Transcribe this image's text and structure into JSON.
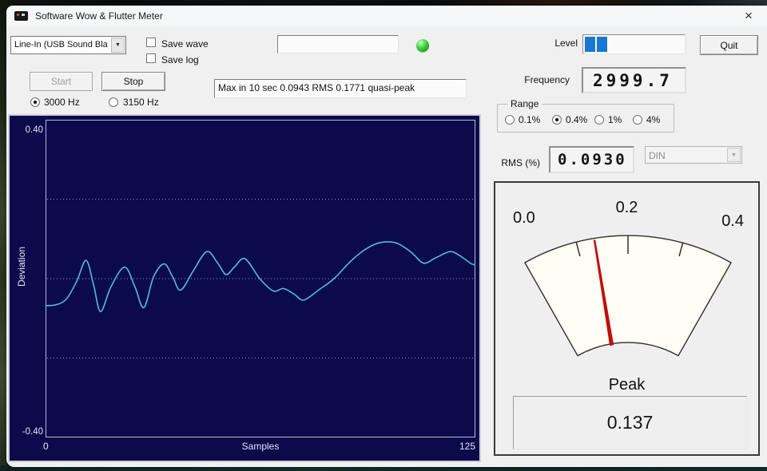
{
  "window": {
    "title": "Software Wow & Flutter Meter",
    "close_glyph": "×"
  },
  "icons": {
    "dropdown_arrow": "▼"
  },
  "controls": {
    "input_device": {
      "value": "Line-In (USB Sound Bla"
    },
    "save_wave": {
      "label": "Save wave",
      "checked": false
    },
    "save_log": {
      "label": "Save log",
      "checked": false
    },
    "filename_value": "",
    "start_label": "Start",
    "stop_label": "Stop",
    "freq_3000": {
      "label": "3000 Hz",
      "selected": true
    },
    "freq_3150": {
      "label": "3150 Hz",
      "selected": false
    },
    "status_text": "Max in 10 sec 0.0943 RMS 0.1771 quasi-peak",
    "level": {
      "label": "Level",
      "segments": 2,
      "color": "#1777d2"
    },
    "quit_label": "Quit",
    "frequency_label": "Frequency",
    "frequency_value": "2999.7",
    "range": {
      "label": "Range",
      "options": [
        {
          "label": "0.1%",
          "selected": false
        },
        {
          "label": "0.4%",
          "selected": true
        },
        {
          "label": "1%",
          "selected": false
        },
        {
          "label": "4%",
          "selected": false
        }
      ]
    },
    "rms_label": "RMS (%)",
    "rms_value": "0.0930",
    "weighting_value": "DIN"
  },
  "meter": {
    "scale_labels": [
      "0.0",
      "0.2",
      "0.4"
    ],
    "min": 0,
    "max": 0.4,
    "value": 0.137,
    "needle_color": "#c40c0c",
    "peak_label": "Peak",
    "peak_value": "0.137"
  },
  "chart_data": {
    "type": "line",
    "title": "",
    "xlabel": "Samples",
    "ylabel": "Deviation",
    "x_ticks": [
      "0",
      "125"
    ],
    "y_tick_top": "0.40",
    "y_tick_bottom": "-0.40",
    "xlim": [
      0,
      125
    ],
    "ylim": [
      -0.4,
      0.4
    ],
    "gridlines_y": [
      0.2,
      0,
      -0.2
    ],
    "legend": "none",
    "series": [
      {
        "name": "deviation",
        "x": [
          0,
          3,
          6,
          9,
          11.8,
          14,
          16,
          19,
          23,
          26,
          28.6,
          31.4,
          34.5,
          37,
          39.3,
          43,
          46.9,
          50,
          52.5,
          55,
          58,
          62.3,
          66.2,
          69.2,
          72.3,
          75.1,
          79.7,
          83.9,
          89,
          93.6,
          97.6,
          102.2,
          106.4,
          109.9,
          113.4,
          117.6,
          120.4,
          123.9,
          125
        ],
        "y": [
          -0.068,
          -0.066,
          -0.052,
          -0.008,
          0.046,
          -0.017,
          -0.083,
          -0.021,
          0.029,
          -0.021,
          -0.073,
          0.004,
          0.037,
          0.004,
          -0.029,
          0.02,
          0.068,
          0.04,
          0.01,
          0.03,
          0.05,
          0.0,
          -0.031,
          -0.025,
          -0.039,
          -0.054,
          -0.027,
          0.0,
          0.046,
          0.077,
          0.091,
          0.089,
          0.066,
          0.039,
          0.052,
          0.068,
          0.058,
          0.037,
          0.036
        ]
      }
    ],
    "colors": {
      "background": "#0b0b4b",
      "line": "#56b8e0",
      "grid": "#9a9ac8",
      "axis": "#b8b8d8",
      "labels": "#e2e2fa"
    }
  }
}
